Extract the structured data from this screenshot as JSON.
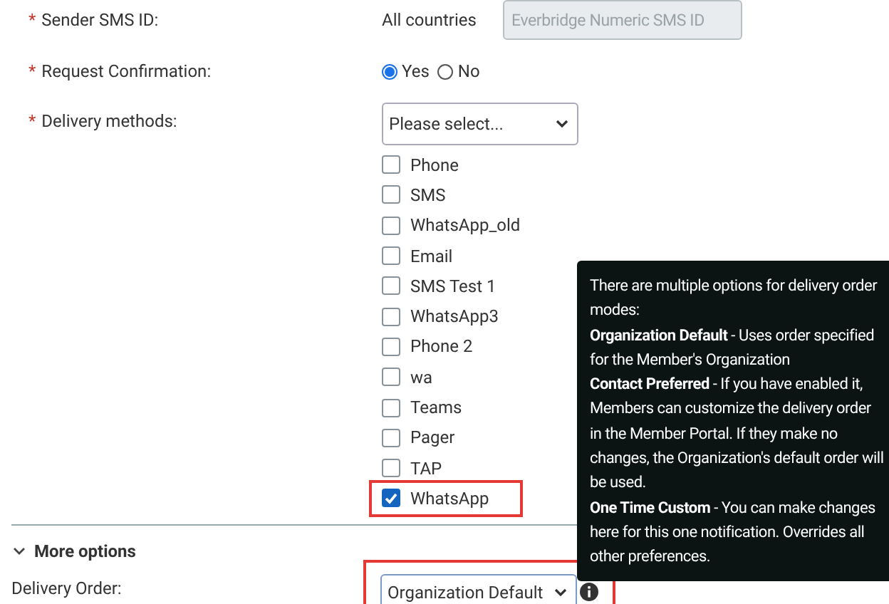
{
  "sender_sms_id": {
    "label": "Sender SMS ID:",
    "required_mark": "*",
    "scope": "All countries",
    "placeholder": "Everbridge Numeric SMS ID"
  },
  "request_confirmation": {
    "label": "Request Confirmation:",
    "required_mark": "*",
    "options": [
      {
        "label": "Yes",
        "selected": true
      },
      {
        "label": "No",
        "selected": false
      }
    ]
  },
  "delivery_methods": {
    "label": "Delivery methods:",
    "required_mark": "*",
    "select": "Please select...",
    "items": [
      {
        "label": "Phone",
        "checked": false,
        "highlighted": false
      },
      {
        "label": "SMS",
        "checked": false,
        "highlighted": false
      },
      {
        "label": "WhatsApp_old",
        "checked": false,
        "highlighted": false
      },
      {
        "label": "Email",
        "checked": false,
        "highlighted": false
      },
      {
        "label": "SMS Test 1",
        "checked": false,
        "highlighted": false
      },
      {
        "label": "WhatsApp3",
        "checked": false,
        "highlighted": false
      },
      {
        "label": "Phone 2",
        "checked": false,
        "highlighted": false
      },
      {
        "label": "wa",
        "checked": false,
        "highlighted": false
      },
      {
        "label": "Teams",
        "checked": false,
        "highlighted": false
      },
      {
        "label": "Pager",
        "checked": false,
        "highlighted": false
      },
      {
        "label": "TAP",
        "checked": false,
        "highlighted": false
      },
      {
        "label": "WhatsApp",
        "checked": true,
        "highlighted": true
      }
    ]
  },
  "more_options": {
    "label": "More options",
    "expanded": true
  },
  "delivery_order": {
    "label": "Delivery Order:",
    "value": "Organization Default",
    "highlighted": true
  },
  "tooltip": [
    "There are multiple options for delivery order modes:",
    "**Organization Default** - Uses order specified for the Member's Organization",
    "**Contact Preferred** - If you have enabled it, Members can customize the delivery order in the Member Portal. If they make no changes, the Organization's default order will be used.",
    "**One Time Custom** - You can make changes here for this one notification. Overrides all other preferences."
  ]
}
